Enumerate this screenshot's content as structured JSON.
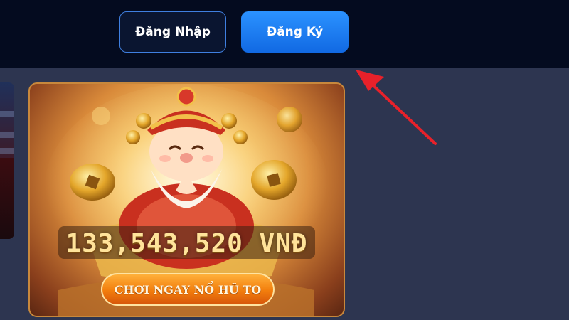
{
  "header": {
    "login_label": "Đăng Nhập",
    "register_label": "Đăng Ký"
  },
  "jackpot": {
    "amount": "133,543,520 VNĐ",
    "cta_label": "CHƠI NGAY NỔ HŨ TO"
  },
  "annotation": {
    "arrow_color": "#e8212a"
  },
  "colors": {
    "header_bg": "#040b1f",
    "content_bg": "#2d3550",
    "register_button": "#1a7ff0",
    "login_border": "#3f7fe0",
    "cta_orange": "#f27d0c"
  }
}
